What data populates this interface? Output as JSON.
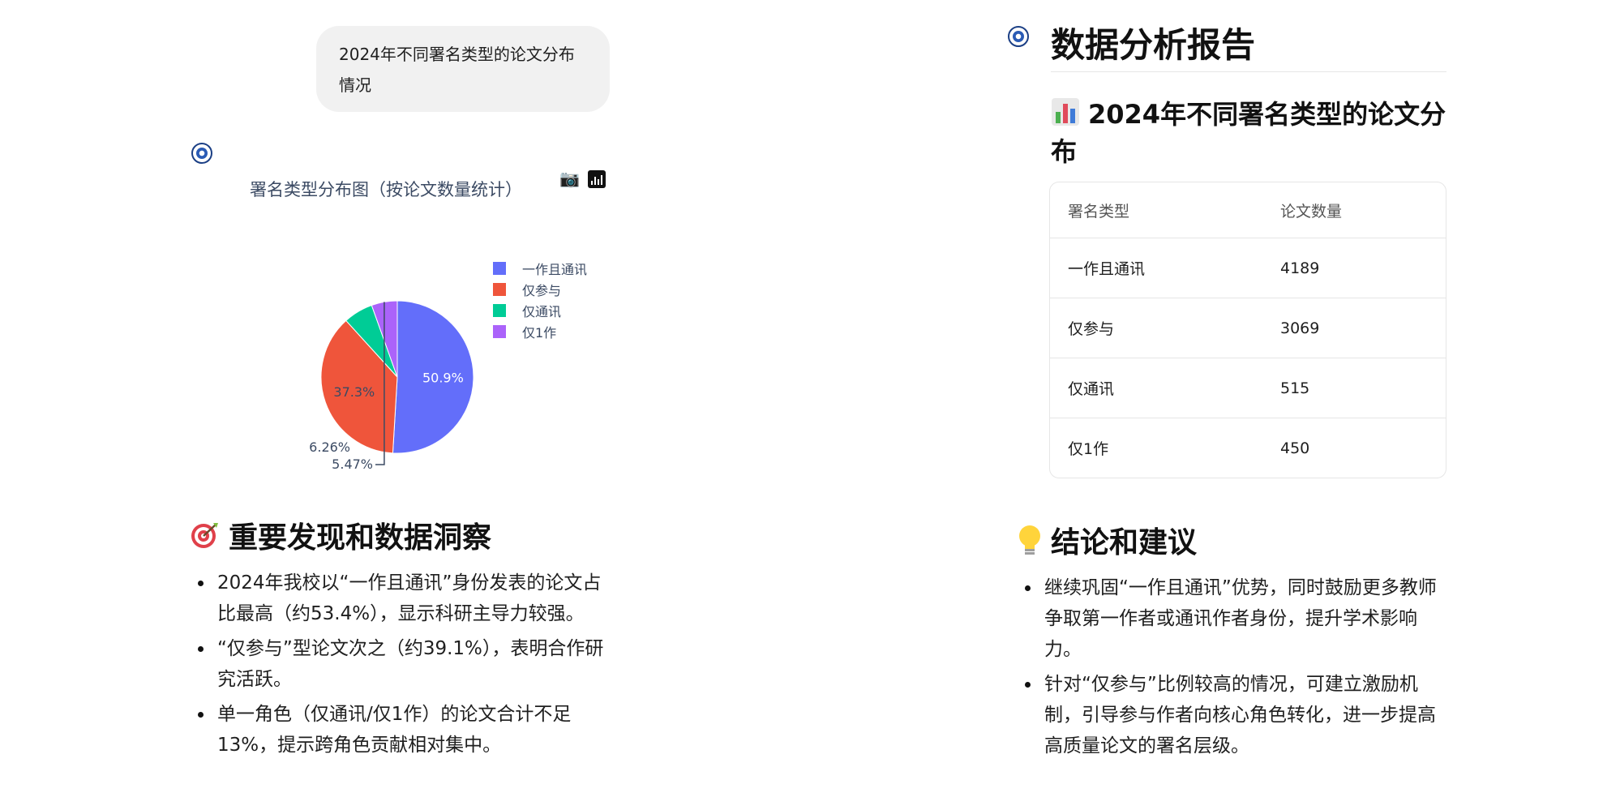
{
  "user_message": "2024年不同署名类型的论文分布情况",
  "chart_toolbar": {
    "camera_icon": "camera-icon",
    "plotly_icon": "plotly-logo-icon"
  },
  "chart_data": {
    "type": "pie",
    "title": "署名类型分布图（按论文数量统计）",
    "labels": [
      "一作且通讯",
      "仅参与",
      "仅通讯",
      "仅1作"
    ],
    "values": [
      4189,
      3069,
      515,
      450
    ],
    "percent_labels": [
      "50.9%",
      "37.3%",
      "6.26%",
      "5.47%"
    ],
    "colors": [
      "#636efa",
      "#ef553b",
      "#00cc96",
      "#ab63fa"
    ],
    "legend_position": "right"
  },
  "findings": {
    "icon": "target-icon",
    "heading": "重要发现和数据洞察",
    "items": [
      "2024年我校以“一作且通讯”身份发表的论文占比最高（约53.4%），显示科研主导力较强。",
      "“仅参与”型论文次之（约39.1%），表明合作研究活跃。",
      "单一角色（仅通讯/仅1作）的论文合计不足13%，提示跨角色贡献相对集中。"
    ]
  },
  "report": {
    "title": "数据分析报告",
    "subtitle_icon": "bar-chart-icon",
    "subtitle": "2024年不同署名类型的论文分布",
    "table": {
      "headers": [
        "署名类型",
        "论文数量"
      ],
      "rows": [
        [
          "一作且通讯",
          "4189"
        ],
        [
          "仅参与",
          "3069"
        ],
        [
          "仅通讯",
          "515"
        ],
        [
          "仅1作",
          "450"
        ]
      ]
    }
  },
  "conclusions": {
    "icon": "lightbulb-icon",
    "heading": "结论和建议",
    "items": [
      "继续巩固“一作且通讯”优势，同时鼓励更多教师争取第一作者或通讯作者身份，提升学术影响力。",
      "针对“仅参与”比例较高的情况，可建立激励机制，引导参与作者向核心角色转化，进一步提高高质量论文的署名层级。"
    ]
  }
}
